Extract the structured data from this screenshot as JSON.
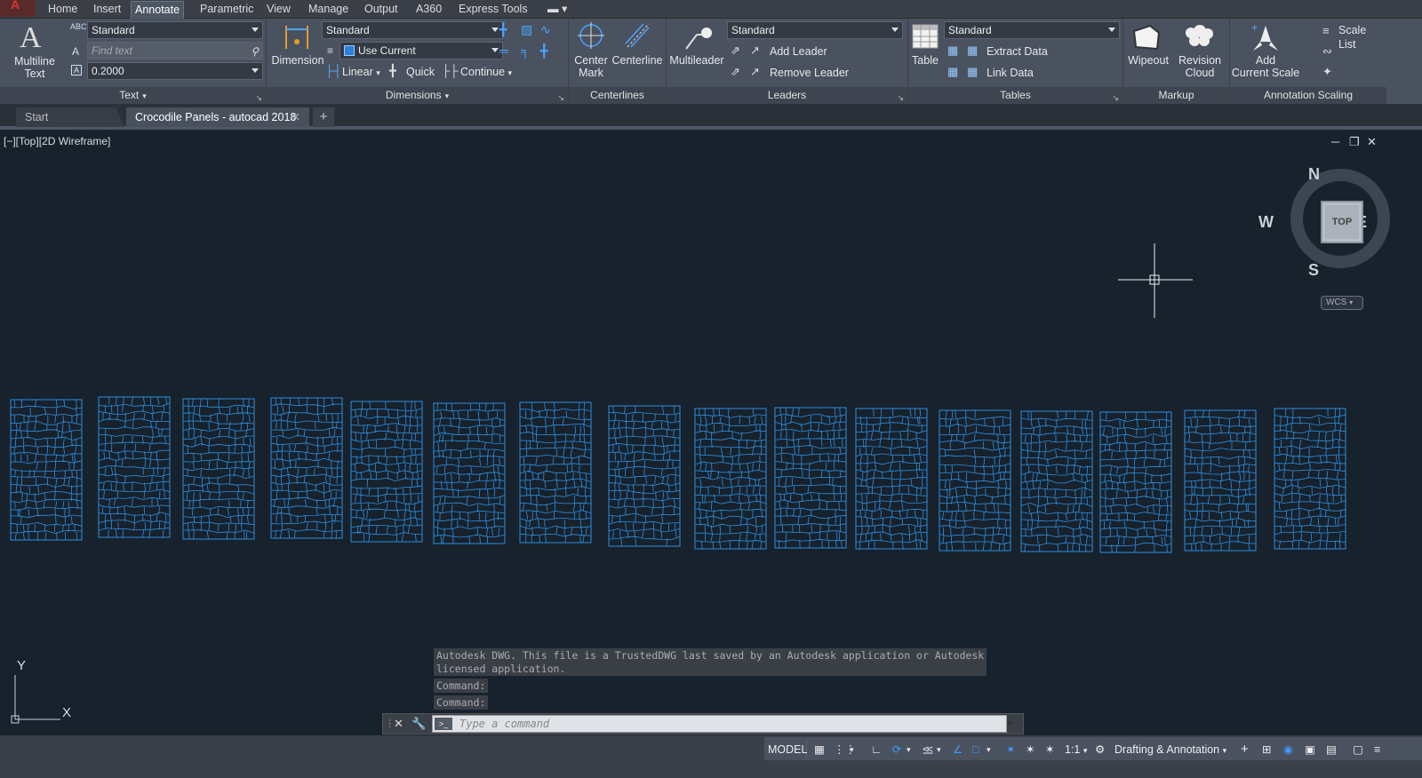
{
  "ribbon_tabs": [
    "Home",
    "Insert",
    "Annotate",
    "Parametric",
    "View",
    "Manage",
    "Output",
    "A360",
    "Express Tools"
  ],
  "active_tab": "Annotate",
  "text_panel": {
    "multiline_text_label_1": "Multiline",
    "multiline_text_label_2": "Text",
    "style_value": "Standard",
    "find_placeholder": "Find text",
    "height_value": "0.2000",
    "panel_label": "Text"
  },
  "dimensions_panel": {
    "dimension_label": "Dimension",
    "style_value": "Standard",
    "layer_value": "Use Current",
    "linear_label": "Linear",
    "quick_label": "Quick",
    "continue_label": "Continue",
    "panel_label": "Dimensions"
  },
  "centerlines_panel": {
    "center_mark_label_1": "Center",
    "center_mark_label_2": "Mark",
    "centerline_label": "Centerline",
    "panel_label": "Centerlines"
  },
  "leaders_panel": {
    "multileader_label": "Multileader",
    "style_value": "Standard",
    "add_leader_label": "Add Leader",
    "remove_leader_label": "Remove Leader",
    "panel_label": "Leaders"
  },
  "tables_panel": {
    "table_label": "Table",
    "style_value": "Standard",
    "extract_data_label": "Extract Data",
    "link_data_label": "Link Data",
    "panel_label": "Tables"
  },
  "markup_panel": {
    "wipeout_label": "Wipeout",
    "revision_cloud_label_1": "Revision",
    "revision_cloud_label_2": "Cloud",
    "panel_label": "Markup"
  },
  "annotation_scaling_panel": {
    "add_scale_label_1": "Add",
    "add_scale_label_2": "Current Scale",
    "scale_list_label": "Scale List",
    "panel_label": "Annotation Scaling"
  },
  "document_tabs": [
    {
      "label": "Start",
      "active": false
    },
    {
      "label": "Crocodile Panels - autocad 2018",
      "active": true
    }
  ],
  "viewport": {
    "label": "[−][Top][2D Wireframe]",
    "viewcube_face": "TOP",
    "compass": {
      "n": "N",
      "s": "S",
      "e": "E",
      "w": "W"
    },
    "ucs_menu": "WCS",
    "axis_x": "X",
    "axis_y": "Y",
    "panel_count": 16,
    "panel_color": "#2e8fe0"
  },
  "command_history": [
    "Autodesk DWG.  This file is a TrustedDWG last saved by an Autodesk application or Autodesk",
    "licensed application.",
    "Command:",
    "Command:"
  ],
  "command_placeholder": "Type a command",
  "status_bar": {
    "model_label": "MODEL",
    "scale_label": "1:1",
    "workspace_label": "Drafting & Annotation"
  }
}
